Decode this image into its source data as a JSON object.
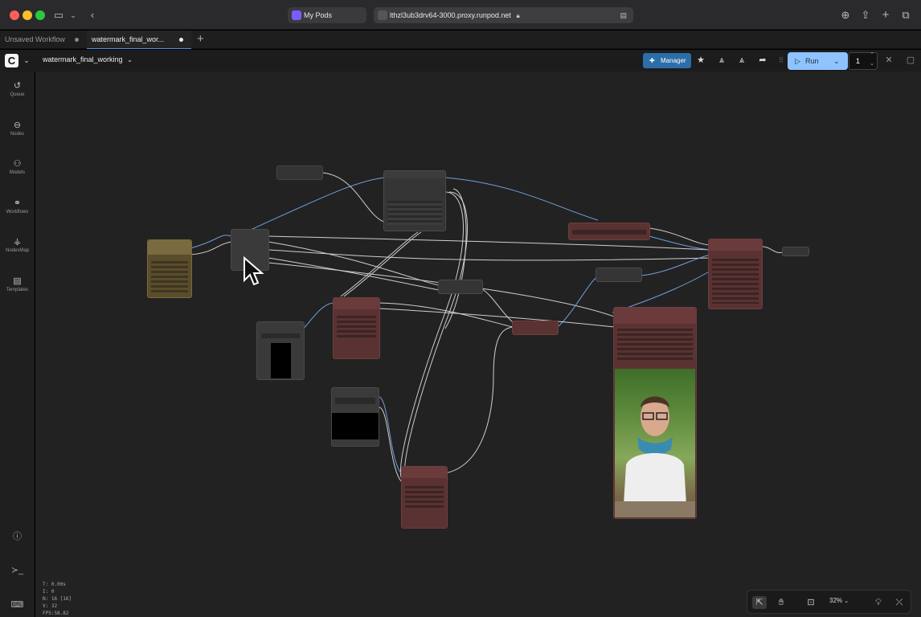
{
  "browser": {
    "tab_label": "My Pods",
    "url": "lthzl3ub3drv64-3000.proxy.runpod.net"
  },
  "workflow_tabs": [
    {
      "label": "Unsaved Workflow"
    },
    {
      "label": "watermark_final_wor..."
    }
  ],
  "toolbar": {
    "workflow_name": "watermark_final_working",
    "manager_label": "Manager",
    "run_label": "Run",
    "batch_count": "1"
  },
  "sidebar": {
    "items": [
      {
        "label": "Queue",
        "icon": "history-icon"
      },
      {
        "label": "Nodes",
        "icon": "nodes-icon"
      },
      {
        "label": "Models",
        "icon": "models-icon"
      },
      {
        "label": "Workflows",
        "icon": "workflows-icon"
      },
      {
        "label": "NodesMap",
        "icon": "nodesmap-icon"
      },
      {
        "label": "Templates",
        "icon": "templates-icon"
      }
    ]
  },
  "stats": {
    "t": "T: 0.00s",
    "i": "I: 0",
    "n": "N: 16 [16]",
    "v": "V: 32",
    "fps": "FPS:58.82"
  },
  "canvas_controls": {
    "zoom": "32%"
  },
  "colors": {
    "accent": "#2b6ea8",
    "run_button": "#8ec3ff",
    "output_node": "#6b3a3a",
    "loader_node": "#6e5e34"
  }
}
